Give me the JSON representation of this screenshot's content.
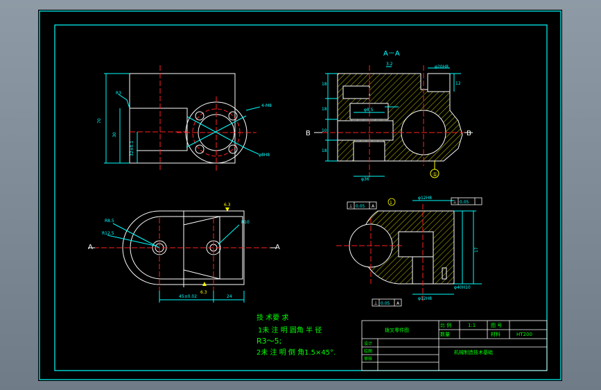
{
  "section_label": "A－A",
  "view_labels": {
    "a_left": "A",
    "a_right": "A",
    "b_left": "B",
    "b_right": "B"
  },
  "balloon": "①",
  "balloon_top": "1",
  "front_view": {
    "dims": [
      "70",
      "30",
      "32±0.1",
      "45",
      "R3",
      "4-M8",
      "φ8H8"
    ]
  },
  "section_view": {
    "dims": [
      "18",
      "18",
      "10",
      "18",
      "18",
      "φ36",
      "φ8.5",
      "3.2",
      "φ20H8",
      "70",
      "12",
      "6.3"
    ]
  },
  "top_view": {
    "dims": [
      "R8.5",
      "R12.5",
      "R10",
      "45±0.02",
      "24",
      "6.3",
      "6.3"
    ]
  },
  "side_view": {
    "tolerance_frames": [
      {
        "symbol": "⊥",
        "value": "0.05",
        "datum": "A"
      },
      {
        "symbol": "⊥",
        "value": "0.05",
        "datum": ""
      },
      {
        "symbol": "⊥",
        "value": "0.05",
        "datum": "A"
      }
    ],
    "dims": [
      "φ12H8",
      "12",
      "φ18",
      "3.2",
      "17",
      "φ12H8",
      "φ40H10",
      "φ12H8"
    ]
  },
  "notes": {
    "title": "技 术要 求",
    "line1": "1未 注 明 圆角 半 径",
    "line2": "R3～5;",
    "line3": "2未 注 明 倒 角1.5×45°."
  },
  "title_block": {
    "part_name": "拨叉零件图",
    "scale_label": "比 例",
    "scale_value": "1:1",
    "drawing_no_label": "图 号",
    "qty_label": "数量",
    "material_label": "材料",
    "material_value": "HT200",
    "designer_label": "设计",
    "drafter_label": "绘图",
    "reviewer_label": "审核",
    "school": "机械制造技术基础"
  },
  "colors": {
    "line": "#ffffff",
    "center": "#ff2020",
    "dim": "#00ffff",
    "hatch": "#ffff00",
    "text": "#00ff00",
    "frame": "#00ffff"
  }
}
